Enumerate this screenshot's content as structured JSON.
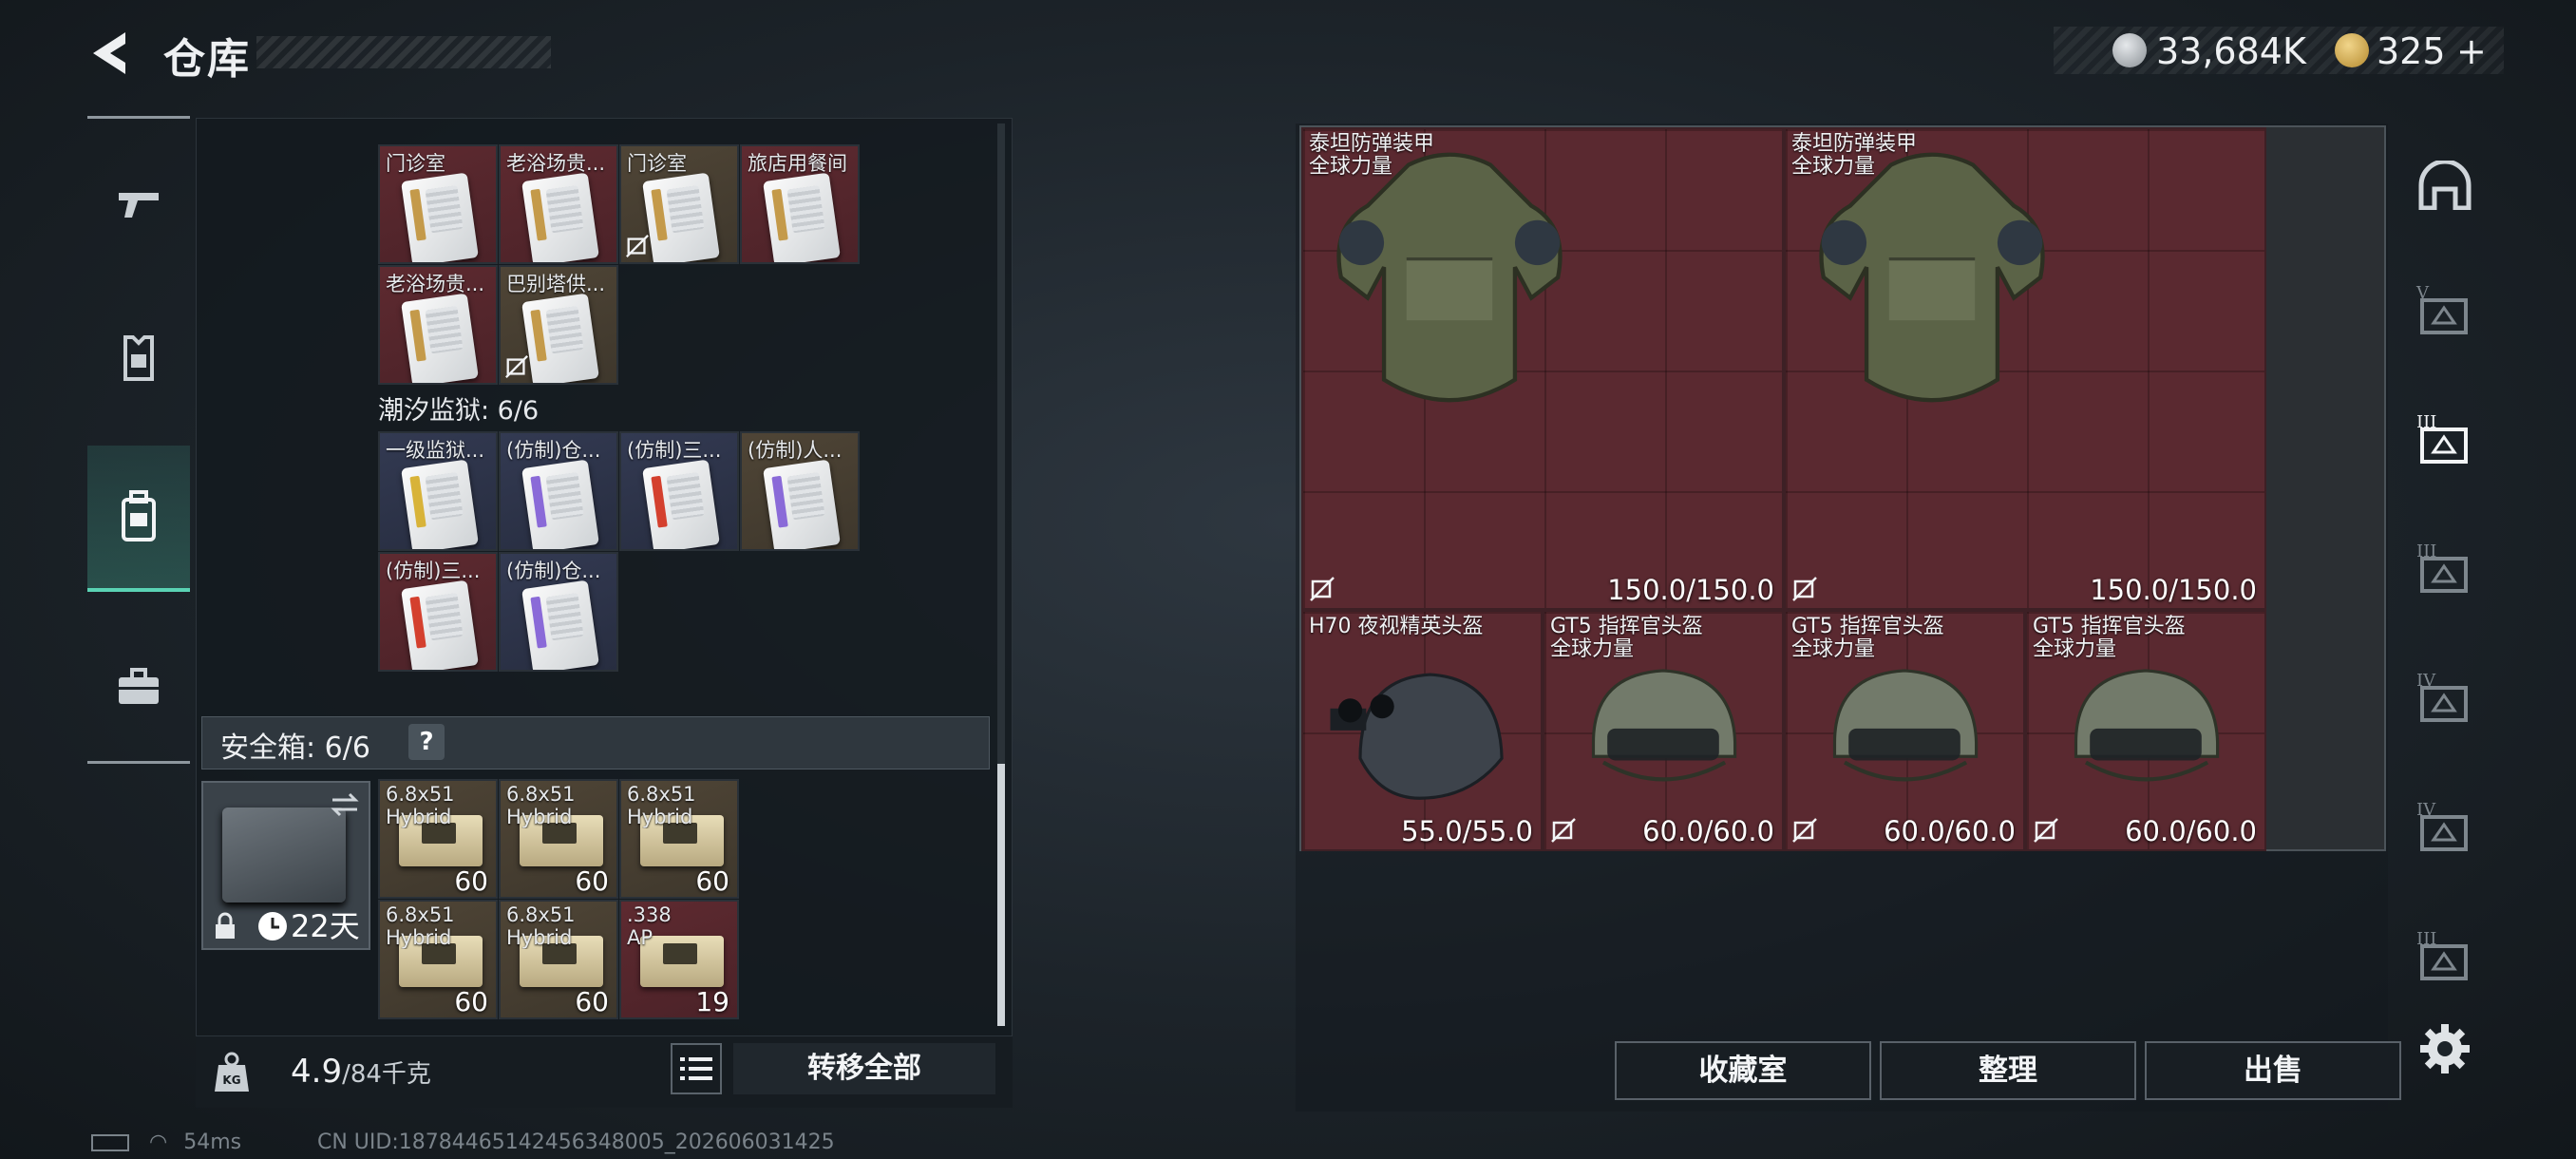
{
  "header": {
    "title": "仓库",
    "currency": [
      {
        "icon": "silver-coin-icon",
        "value": "33,684K"
      },
      {
        "icon": "gold-coin-icon",
        "value": "325"
      }
    ],
    "plus": "+"
  },
  "left_nav": [
    "gun-icon",
    "armor-icon",
    "backpack-icon",
    "briefcase-icon"
  ],
  "cards_top": [
    {
      "label": "门诊室",
      "color": "red",
      "stripe": "#c49a4a",
      "no_trade": false
    },
    {
      "label": "老浴场贵...",
      "color": "red",
      "stripe": "#c49a4a",
      "no_trade": false
    },
    {
      "label": "门诊室",
      "color": "brown",
      "stripe": "#c49a4a",
      "no_trade": true
    },
    {
      "label": "旅店用餐间",
      "color": "red",
      "stripe": "#c49a4a",
      "no_trade": false
    },
    {
      "label": "老浴场贵...",
      "color": "red",
      "stripe": "#c49a4a",
      "no_trade": false
    },
    {
      "label": "巴别塔供...",
      "color": "brown",
      "stripe": "#c49a4a",
      "no_trade": true
    }
  ],
  "section": {
    "title": "潮汐监狱: 6/6"
  },
  "cards_prison": [
    {
      "label": "一级监狱...",
      "color": "navy",
      "stripe": "#d8b339",
      "no_trade": false
    },
    {
      "label": "(仿制)仓...",
      "color": "navy",
      "stripe": "#8a6ad8",
      "no_trade": false
    },
    {
      "label": "(仿制)三...",
      "color": "navy",
      "stripe": "#d4402e",
      "no_trade": false
    },
    {
      "label": "(仿制)人...",
      "color": "brown",
      "stripe": "#8a6ad8",
      "no_trade": false
    },
    {
      "label": "(仿制)三...",
      "color": "red",
      "stripe": "#d4402e",
      "no_trade": false
    },
    {
      "label": "(仿制)仓...",
      "color": "navy",
      "stripe": "#8a6ad8",
      "no_trade": false
    }
  ],
  "safe": {
    "label": "安全箱: 6/6",
    "help": "?",
    "days": "22天"
  },
  "ammo": [
    {
      "label": "6.8x51\nHybrid",
      "count": "60",
      "color": "brown"
    },
    {
      "label": "6.8x51\nHybrid",
      "count": "60",
      "color": "brown"
    },
    {
      "label": "6.8x51\nHybrid",
      "count": "60",
      "color": "brown"
    },
    {
      "label": "6.8x51\nHybrid",
      "count": "60",
      "color": "brown"
    },
    {
      "label": "6.8x51\nHybrid",
      "count": "60",
      "color": "brown"
    },
    {
      "label": ".338\nAP",
      "count": "19",
      "color": "red"
    }
  ],
  "bottom": {
    "weight": "4.9",
    "weight_max": "/84千克",
    "transfer": "转移全部"
  },
  "status": {
    "ping": "54ms",
    "uid": "CN UID:18784465142456348005_202606031425"
  },
  "armor": [
    {
      "label": "泰坦防弹装甲\n全球力量",
      "durability": "150.0/150.0"
    },
    {
      "label": "泰坦防弹装甲\n全球力量",
      "durability": "150.0/150.0"
    }
  ],
  "helmets": [
    {
      "label": "H70 夜视精英头盔",
      "durability": "55.0/55.0",
      "no_trade": false,
      "kind": "night"
    },
    {
      "label": "GT5 指挥官头盔\n全球力量",
      "durability": "60.0/60.0",
      "no_trade": true,
      "kind": "gt5"
    },
    {
      "label": "GT5 指挥官头盔\n全球力量",
      "durability": "60.0/60.0",
      "no_trade": true,
      "kind": "gt5"
    },
    {
      "label": "GT5 指挥官头盔\n全球力量",
      "durability": "60.0/60.0",
      "no_trade": true,
      "kind": "gt5"
    }
  ],
  "right_nav": [
    {
      "icon": "dome-icon",
      "tier": ""
    },
    {
      "icon": "armor-rack-icon",
      "tier": "V"
    },
    {
      "icon": "armor-rack-icon",
      "tier": "III"
    },
    {
      "icon": "armor-rack-icon",
      "tier": "III"
    },
    {
      "icon": "armor-rack-icon",
      "tier": "IV"
    },
    {
      "icon": "armor-rack-add-icon",
      "tier": "IV"
    },
    {
      "icon": "armor-rack-icon",
      "tier": "III"
    }
  ],
  "actions": {
    "collection": "收藏室",
    "sort": "整理",
    "sell": "出售"
  }
}
